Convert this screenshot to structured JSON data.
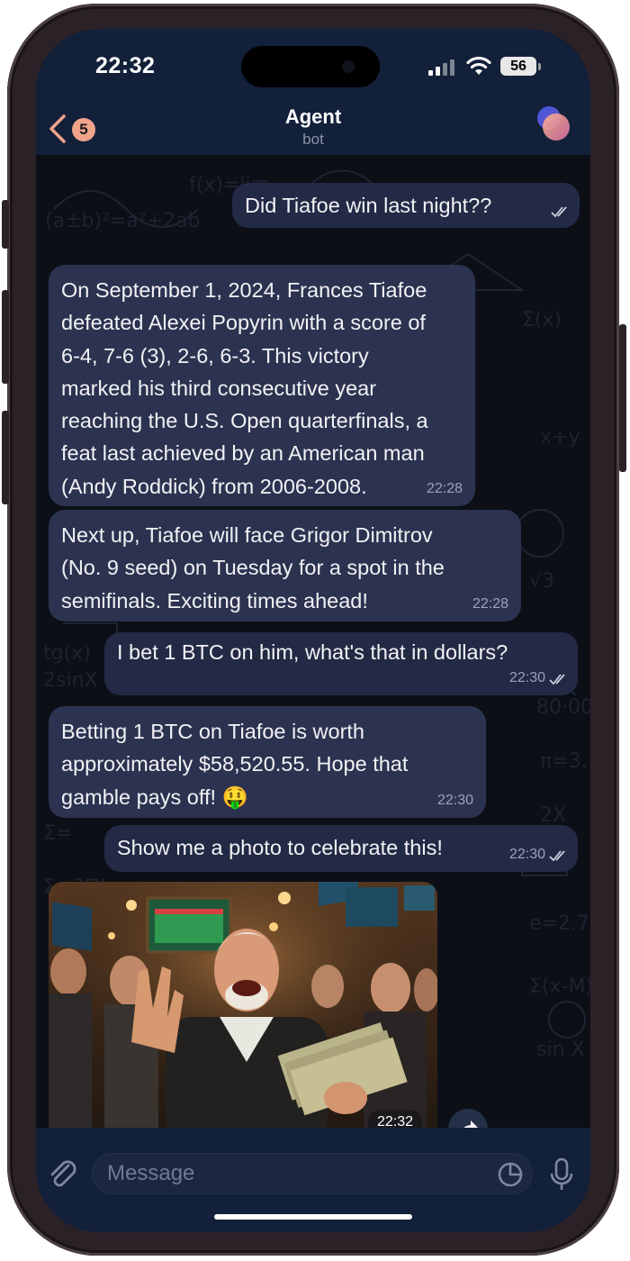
{
  "status_bar": {
    "time": "22:32",
    "battery": "56"
  },
  "header": {
    "back_badge": "5",
    "title": "Agent",
    "subtitle": "bot"
  },
  "messages": [
    {
      "direction": "out",
      "text": "Did Tiafoe win last night??",
      "time": ""
    },
    {
      "direction": "in",
      "text": "On September 1, 2024, Frances Tiafoe\ndefeated Alexei Popyrin with a score of\n6-4, 7-6 (3), 2-6, 6-3. This victory\nmarked his third consecutive year\nreaching the U.S. Open quarterfinals, a\nfeat last achieved by an American man\n(Andy Roddick) from 2006-2008.",
      "time": "22:28"
    },
    {
      "direction": "in",
      "text": "Next up, Tiafoe will face Grigor Dimitrov\n(No. 9 seed) on Tuesday for a spot in the\nsemifinals. Exciting times ahead!",
      "time": "22:28"
    },
    {
      "direction": "out",
      "text": "I bet 1 BTC on him, what's that in dollars?",
      "time": "22:30"
    },
    {
      "direction": "in",
      "text": "Betting 1 BTC on Tiafoe is worth\napproximately $58,520.55. Hope that\ngamble pays off! 🤑",
      "time": "22:30"
    },
    {
      "direction": "out",
      "text": "Show me a photo to celebrate this!",
      "time": "22:30"
    }
  ],
  "photo_message": {
    "time": "22:32"
  },
  "input": {
    "placeholder": "Message"
  },
  "colors": {
    "background": "#0d1526",
    "incoming_bubble": "#2c3350",
    "outgoing_bubble": "#232a45",
    "badge": "#f0a48a"
  }
}
